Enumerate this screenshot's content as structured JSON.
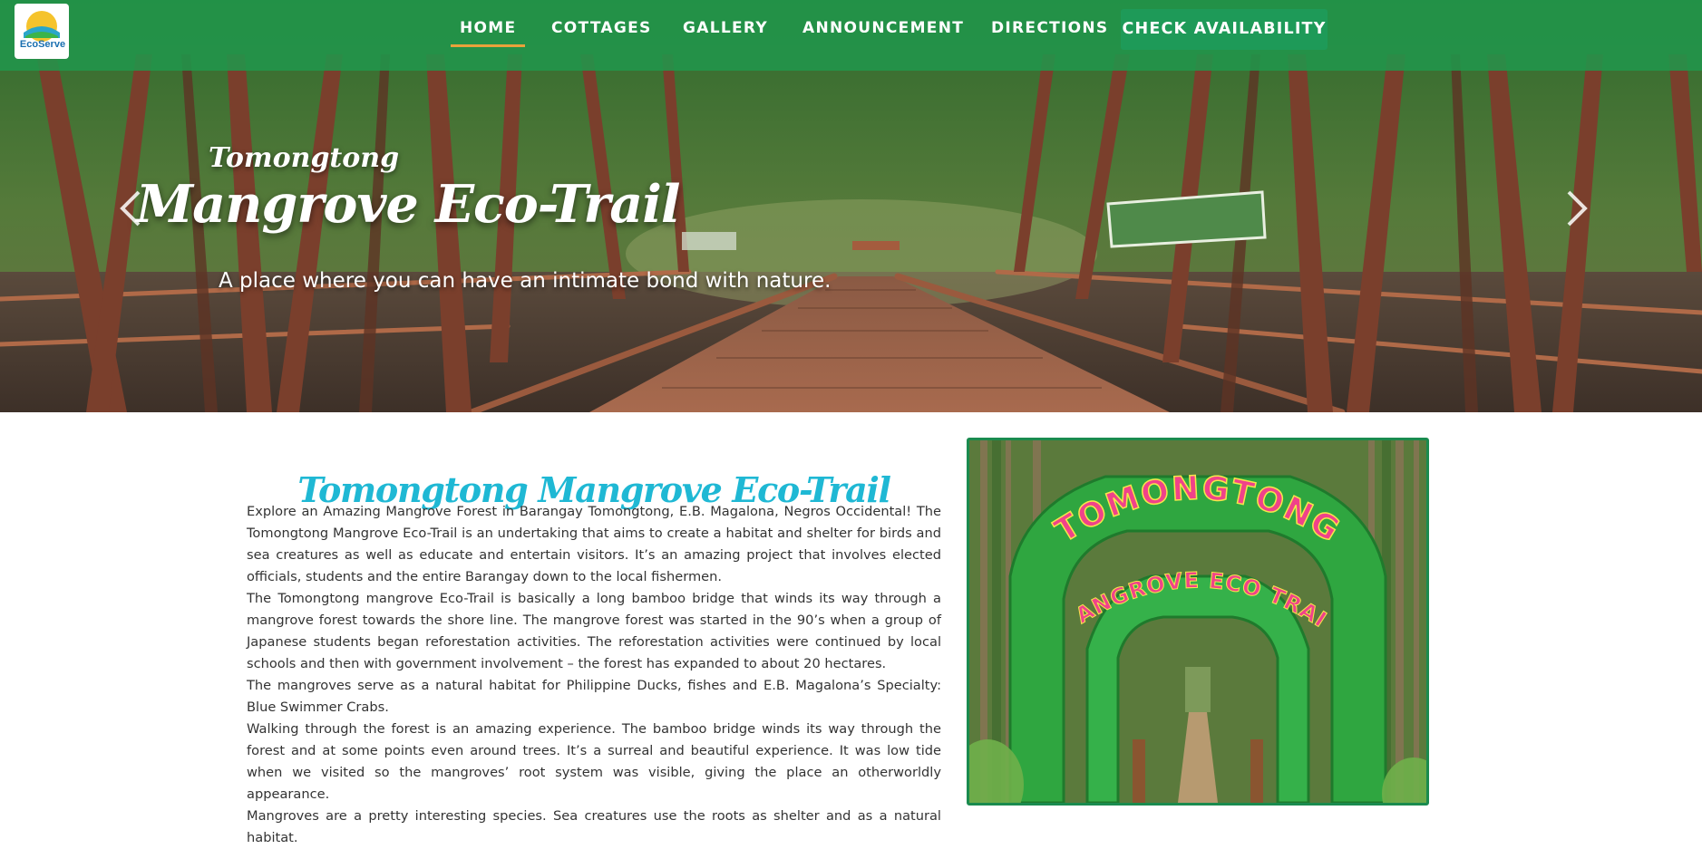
{
  "nav": {
    "logo_text": "EcoServe",
    "items": [
      {
        "label": "HOME",
        "active": true
      },
      {
        "label": "COTTAGES",
        "active": false
      },
      {
        "label": "GALLERY",
        "active": false
      },
      {
        "label": "ANNOUNCEMENT",
        "active": false
      },
      {
        "label": "DIRECTIONS",
        "active": false
      }
    ],
    "cta": "CHECK AVAILABILITY"
  },
  "hero": {
    "pretitle": "Tomongtong",
    "title": "Mangrove Eco-Trail",
    "subtitle": "A place where you can have an intimate bond with nature.",
    "prev_icon": "chevron-left-icon",
    "next_icon": "chevron-right-icon"
  },
  "content": {
    "title": "Tomongtong Mangrove Eco-Trail",
    "paragraphs": [
      "Explore an Amazing Mangrove Forest in Barangay Tomongtong, E.B. Magalona, Negros Occidental! The Tomongtong Mangrove Eco-Trail is an undertaking that aims to create a habitat and shelter for birds and sea creatures as well as educate and entertain visitors. It’s an amazing project that involves elected officials, students and the entire Barangay down to the local fishermen.",
      "The Tomongtong mangrove Eco-Trail is basically a long bamboo bridge that winds its way through a mangrove forest towards the shore line. The mangrove forest was started in the 90’s when a group of Japanese students began reforestation activities. The reforestation activities were continued by local schools and then with government involvement – the forest has expanded to about 20 hectares.",
      "The mangroves serve as a natural habitat for Philippine Ducks, fishes and E.B. Magalona’s Specialty: Blue Swimmer Crabs.",
      "Walking through the forest is an amazing experience. The bamboo bridge winds its way through the forest and at some points even around trees. It’s a surreal and beautiful experience. It was low tide when we visited so the mangroves’ root system was visible, giving the place an otherworldly appearance.",
      "Mangroves are a pretty interesting species. Sea creatures use the roots as shelter and as a natural habitat."
    ],
    "photo_arch_top": "TOMONGTONG",
    "photo_arch_bottom": "MANGROVE ECO TRAIL"
  },
  "colors": {
    "nav_green": "#21964b",
    "cta_green": "#1e9a58",
    "active_underline": "#e9a23b",
    "title_cyan": "#1fb8d4",
    "frame_green": "#1a8b4f"
  }
}
